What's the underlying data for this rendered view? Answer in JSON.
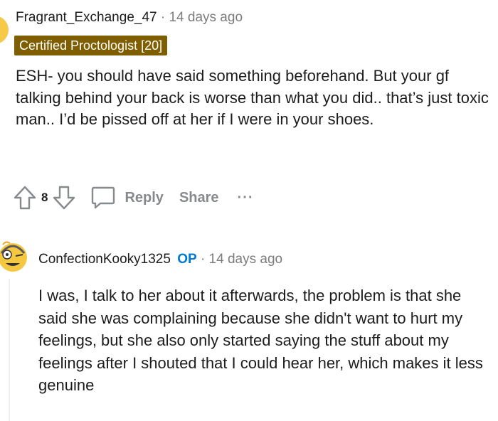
{
  "comment": {
    "username": "Fragrant_Exchange_47",
    "separator": "·",
    "timestamp": "14 days ago",
    "flair": "Certified Proctologist [20]",
    "body": "ESH- you should have said something beforehand. But your gf talking behind your back is worse than what you did.. that’s just toxic man.. I’d be pissed off at her if I were in your shoes.",
    "votes": "8",
    "reply_label": "Reply",
    "share_label": "Share",
    "more_label": "···"
  },
  "reply": {
    "username": "ConfectionKooky1325",
    "op_badge": "OP",
    "separator": "·",
    "timestamp": "14 days ago",
    "body": "I was, I talk to her about it afterwards, the problem is that she said she was complaining because she didn't want to hurt my feelings, but she also only started saying the stuff about my feelings after I shouted that I could hear her, which makes it less genuine"
  },
  "colors": {
    "flair_bg": "#7f5e00",
    "op_blue": "#0079d3",
    "muted_gray": "#878a8c",
    "avatar_yellow": "#f7c948"
  },
  "icons": [
    "upvote-icon",
    "downvote-icon",
    "comment-icon",
    "more-icon",
    "avatar"
  ]
}
